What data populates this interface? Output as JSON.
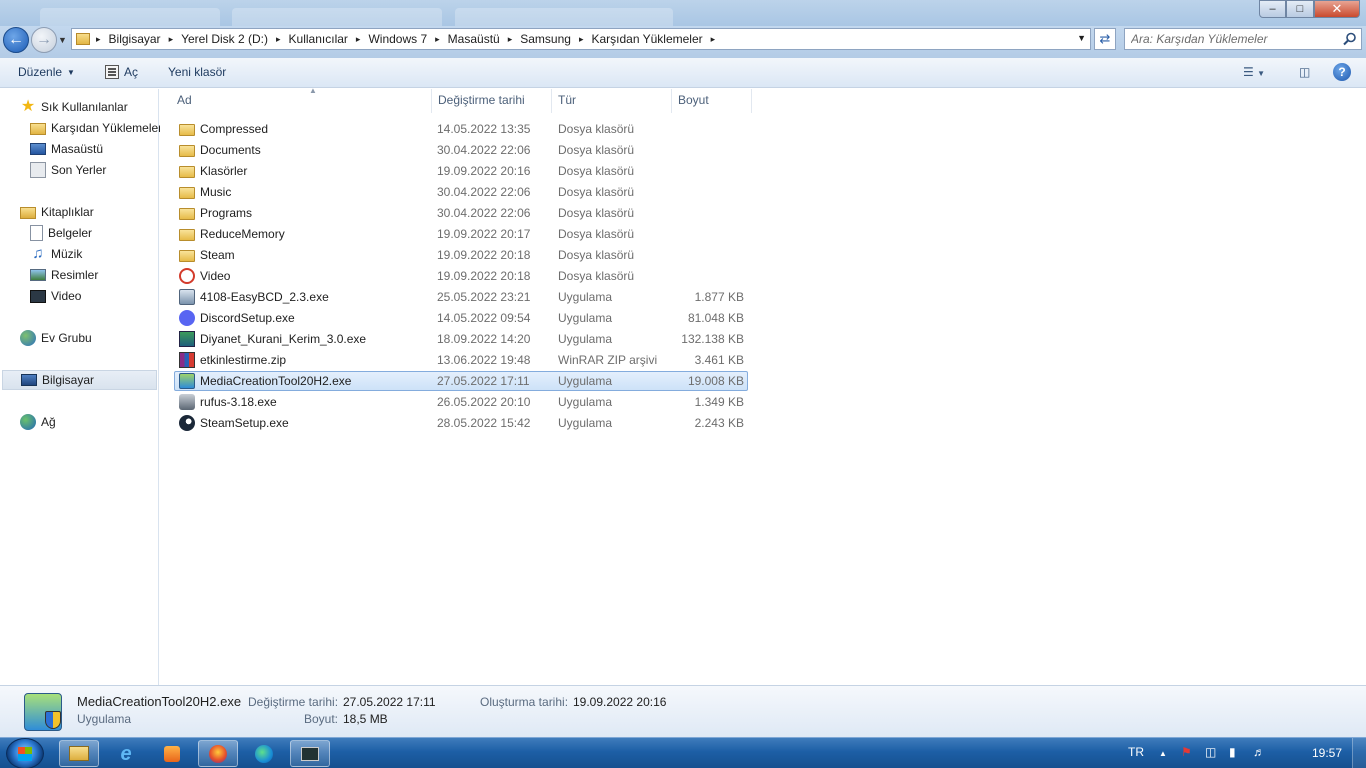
{
  "window": {
    "minimize": "–",
    "maximize": "□",
    "close": "✕"
  },
  "nav": {
    "back_icon": "back-arrow-icon",
    "forward_icon": "forward-arrow-icon"
  },
  "address": {
    "crumbs": [
      "Bilgisayar",
      "Yerel Disk 2 (D:)",
      "Kullanıcılar",
      "Windows 7",
      "Masaüstü",
      "Samsung",
      "Karşıdan Yüklemeler"
    ],
    "separator": "▸"
  },
  "search": {
    "placeholder": "Ara: Karşıdan Yüklemeler"
  },
  "toolbar": {
    "organize": "Düzenle",
    "open": "Aç",
    "new_folder": "Yeni klasör"
  },
  "sidebar": {
    "favorites": {
      "label": "Sık Kullanılanlar",
      "items": [
        "Karşıdan Yüklemeler",
        "Masaüstü",
        "Son Yerler"
      ]
    },
    "libraries": {
      "label": "Kitaplıklar",
      "items": [
        "Belgeler",
        "Müzik",
        "Resimler",
        "Video"
      ]
    },
    "homegroup": "Ev Grubu",
    "computer": "Bilgisayar",
    "network": "Ağ"
  },
  "columns": {
    "name": "Ad",
    "date": "Değiştirme tarihi",
    "type": "Tür",
    "size": "Boyut"
  },
  "files": [
    {
      "name": "Compressed",
      "date": "14.05.2022 13:35",
      "type": "Dosya klasörü",
      "size": "",
      "icon": "folder-icon"
    },
    {
      "name": "Documents",
      "date": "30.04.2022 22:06",
      "type": "Dosya klasörü",
      "size": "",
      "icon": "folder-icon"
    },
    {
      "name": "Klasörler",
      "date": "19.09.2022 20:16",
      "type": "Dosya klasörü",
      "size": "",
      "icon": "folder-icon"
    },
    {
      "name": "Music",
      "date": "30.04.2022 22:06",
      "type": "Dosya klasörü",
      "size": "",
      "icon": "folder-icon"
    },
    {
      "name": "Programs",
      "date": "30.04.2022 22:06",
      "type": "Dosya klasörü",
      "size": "",
      "icon": "folder-icon"
    },
    {
      "name": "ReduceMemory",
      "date": "19.09.2022 20:17",
      "type": "Dosya klasörü",
      "size": "",
      "icon": "folder-icon"
    },
    {
      "name": "Steam",
      "date": "19.09.2022 20:18",
      "type": "Dosya klasörü",
      "size": "",
      "icon": "folder-icon"
    },
    {
      "name": "Video",
      "date": "19.09.2022 20:18",
      "type": "Dosya klasörü",
      "size": "",
      "icon": "video-folder-icon"
    },
    {
      "name": "4108-EasyBCD_2.3.exe",
      "date": "25.05.2022 23:21",
      "type": "Uygulama",
      "size": "1.877 KB",
      "icon": "easybcd-icon"
    },
    {
      "name": "DiscordSetup.exe",
      "date": "14.05.2022 09:54",
      "type": "Uygulama",
      "size": "81.048 KB",
      "icon": "discord-icon"
    },
    {
      "name": "Diyanet_Kurani_Kerim_3.0.exe",
      "date": "18.09.2022 14:20",
      "type": "Uygulama",
      "size": "132.138 KB",
      "icon": "diyanet-icon"
    },
    {
      "name": "etkinlestirme.zip",
      "date": "13.06.2022 19:48",
      "type": "WinRAR ZIP arşivi",
      "size": "3.461 KB",
      "icon": "winrar-icon"
    },
    {
      "name": "MediaCreationTool20H2.exe",
      "date": "27.05.2022 17:11",
      "type": "Uygulama",
      "size": "19.008 KB",
      "icon": "media-creation-tool-icon",
      "selected": true
    },
    {
      "name": "rufus-3.18.exe",
      "date": "26.05.2022 20:10",
      "type": "Uygulama",
      "size": "1.349 KB",
      "icon": "rufus-icon"
    },
    {
      "name": "SteamSetup.exe",
      "date": "28.05.2022 15:42",
      "type": "Uygulama",
      "size": "2.243 KB",
      "icon": "steam-icon"
    }
  ],
  "details": {
    "filename": "MediaCreationTool20H2.exe",
    "kind": "Uygulama",
    "modified_label": "Değiştirme tarihi:",
    "modified_value": "27.05.2022 17:11",
    "created_label": "Oluşturma tarihi:",
    "created_value": "19.09.2022 20:16",
    "size_label": "Boyut:",
    "size_value": "18,5 MB"
  },
  "taskbar": {
    "apps": [
      "explorer-icon",
      "internet-explorer-icon",
      "media-player-icon",
      "firefox-icon",
      "edge-icon",
      "remote-desktop-icon"
    ],
    "language": "TR",
    "time": "19:57"
  },
  "colors": {
    "selection_border": "#84acdd",
    "selection_fill": "#cde2f8",
    "taskbar": "#1d5fa6"
  }
}
